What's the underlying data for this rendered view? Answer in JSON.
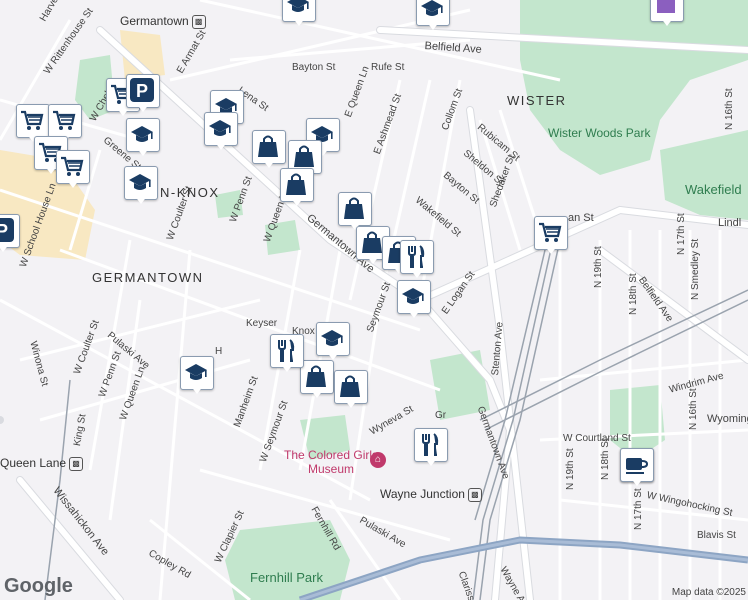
{
  "map": {
    "colors": {
      "background": "#f3f2f5",
      "park": "#c3e6cd",
      "road_major": "#ffffff",
      "road_casing": "#d9dbe0",
      "rail": "#9aa3ae",
      "transit": "#8da5c4",
      "marker_icon": "#1a3c63",
      "campus": "#f8e8c2"
    },
    "areas": [
      "WISTER",
      "GERMANTOWN",
      "N-KNOX"
    ],
    "streets": [
      {
        "text": "Belfield Ave"
      },
      {
        "text": "Bayton St"
      },
      {
        "text": "Rufe St"
      },
      {
        "text": "Lena St"
      },
      {
        "text": "E Queen Ln"
      },
      {
        "text": "E Ashmead St"
      },
      {
        "text": "Collom St"
      },
      {
        "text": "Rubicam St"
      },
      {
        "text": "Sheldon St"
      },
      {
        "text": "Bayton St"
      },
      {
        "text": "Shedaker St"
      },
      {
        "text": "Wakefield St"
      },
      {
        "text": "Germantown Ave"
      },
      {
        "text": "W Penn St"
      },
      {
        "text": "W Queen Ln"
      },
      {
        "text": "W Coulter St"
      },
      {
        "text": "W School House Ln"
      },
      {
        "text": "W Coulter St"
      },
      {
        "text": "Pulaski Ave"
      },
      {
        "text": "W Penn St"
      },
      {
        "text": "W Queen Ln"
      },
      {
        "text": "Winona St"
      },
      {
        "text": "King St"
      },
      {
        "text": "Wissahickon Ave"
      },
      {
        "text": "E Logan St"
      },
      {
        "text": "Seymour St"
      },
      {
        "text": "Stenton Ave"
      },
      {
        "text": "Germantown Ave"
      },
      {
        "text": "Manheim St"
      },
      {
        "text": "W Seymour St"
      },
      {
        "text": "Wyneva St"
      },
      {
        "text": "W Clapier St"
      },
      {
        "text": "Copley Rd"
      },
      {
        "text": "Fernhill Rd"
      },
      {
        "text": "Pulaski Ave"
      },
      {
        "text": "Windrim Ave"
      },
      {
        "text": "W Courtland St"
      },
      {
        "text": "W Wingohocking St"
      },
      {
        "text": "Blavis St"
      },
      {
        "text": "N 19th St"
      },
      {
        "text": "N 18th St"
      },
      {
        "text": "N Smedley St"
      },
      {
        "text": "N 17th St"
      },
      {
        "text": "N 16th St"
      },
      {
        "text": "N 19th St"
      },
      {
        "text": "N 18th St"
      },
      {
        "text": "N 16th St"
      },
      {
        "text": "N 17th St"
      },
      {
        "text": "Belfield Ave"
      },
      {
        "text": "Lindl"
      },
      {
        "text": "W Rittenhouse St"
      },
      {
        "text": "E Armat St"
      },
      {
        "text": "W Chelt"
      },
      {
        "text": "Greene St"
      },
      {
        "text": "Harvey"
      },
      {
        "text": "Wyoming"
      },
      {
        "text": "Clarissa"
      },
      {
        "text": "Wayne Av"
      },
      {
        "text": "Keyser"
      },
      {
        "text": "Knox"
      },
      {
        "text": "H"
      },
      {
        "text": "Gr"
      },
      {
        "text": "an St"
      }
    ],
    "parks": [
      "Wister Woods Park",
      "Wakefield",
      "Fernhill Park"
    ],
    "pois": [
      "The Colored Girls Museum"
    ],
    "stations": [
      "Germantown",
      "Queen Lane",
      "Wayne Junction"
    ],
    "markers": [
      {
        "icon": "school"
      },
      {
        "icon": "school"
      },
      {
        "icon": "school"
      },
      {
        "icon": "school"
      },
      {
        "icon": "school"
      },
      {
        "icon": "school"
      },
      {
        "icon": "school"
      },
      {
        "icon": "school"
      },
      {
        "icon": "school"
      },
      {
        "icon": "school"
      },
      {
        "icon": "grocery"
      },
      {
        "icon": "grocery"
      },
      {
        "icon": "grocery"
      },
      {
        "icon": "grocery"
      },
      {
        "icon": "grocery"
      },
      {
        "icon": "grocery"
      },
      {
        "icon": "shopping-bag"
      },
      {
        "icon": "shopping-bag"
      },
      {
        "icon": "shopping-bag"
      },
      {
        "icon": "shopping-bag"
      },
      {
        "icon": "shopping-bag"
      },
      {
        "icon": "shopping-bag"
      },
      {
        "icon": "shopping-bag"
      },
      {
        "icon": "shopping-bag"
      },
      {
        "icon": "restaurant"
      },
      {
        "icon": "restaurant"
      },
      {
        "icon": "restaurant"
      },
      {
        "icon": "restaurant"
      },
      {
        "icon": "cafe"
      },
      {
        "icon": "parking"
      },
      {
        "icon": "parking"
      },
      {
        "icon": "building"
      }
    ],
    "logo": "Google",
    "credit": "Map data ©2025"
  }
}
